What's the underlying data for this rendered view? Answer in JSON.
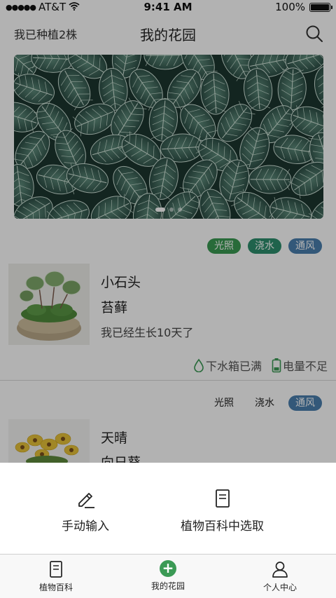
{
  "status_bar": {
    "carrier": "AT&T",
    "time": "9:41 AM",
    "battery": "100%",
    "battery_level": 1.0
  },
  "header": {
    "planted_count": "我已种植2株",
    "title": "我的花园"
  },
  "banner": {
    "slides": 3,
    "active_slide": 1
  },
  "plants": [
    {
      "tags": [
        {
          "label": "光照",
          "style": "green"
        },
        {
          "label": "浇水",
          "style": "teal"
        },
        {
          "label": "通风",
          "style": "blue"
        }
      ],
      "name": "小石头",
      "species": "苔藓",
      "days": "我已经生长10天了",
      "water_status": "下水箱已满",
      "battery_status": "电量不足"
    },
    {
      "tags": [
        {
          "label": "光照",
          "style": "plain"
        },
        {
          "label": "浇水",
          "style": "plain"
        },
        {
          "label": "通风",
          "style": "blue"
        }
      ],
      "name": "天晴",
      "species": "向日葵"
    }
  ],
  "sheet": {
    "manual_input": "手动输入",
    "pick_from_encyclopedia": "植物百科中选取"
  },
  "tab_bar": {
    "tabs": [
      {
        "label": "植物百科",
        "icon": "book-icon"
      },
      {
        "label": "我的花园",
        "icon": "plus-icon"
      },
      {
        "label": "个人中心",
        "icon": "person-icon"
      }
    ]
  },
  "colors": {
    "tag_green": "#3a9a52",
    "tag_teal": "#2d8f6d",
    "tag_blue": "#4a7fae",
    "accent_green": "#3b9a55",
    "overlay": "rgba(0,0,0,0.30)"
  }
}
